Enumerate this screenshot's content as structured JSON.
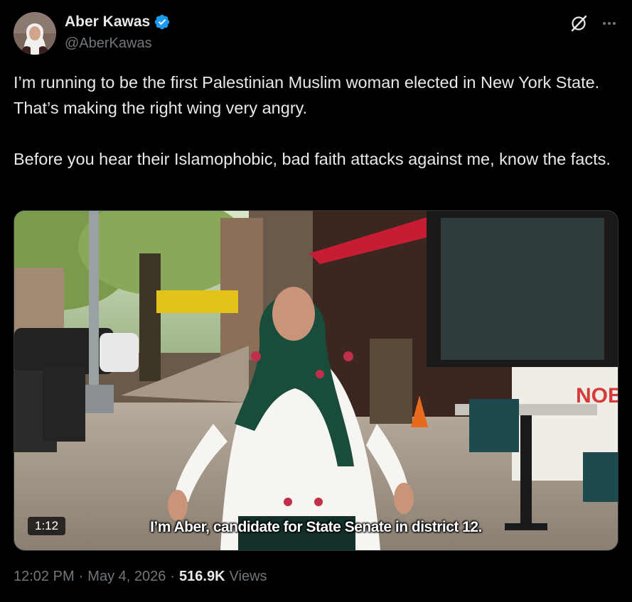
{
  "author": {
    "name": "Aber Kawas",
    "handle": "@AberKawas",
    "verified_color": "#1d9bf0"
  },
  "icons": {
    "grok": "grok-icon",
    "more": "more-icon",
    "verified": "verified-badge-icon"
  },
  "tweet": {
    "paragraph_1": "I’m running to be the first Palestinian Muslim woman elected in New York State. That’s making the right wing very angry.",
    "paragraph_2": "Before you hear their Islamophobic, bad faith attacks against me, know the facts."
  },
  "video": {
    "duration": "1:12",
    "caption": "I’m Aber, candidate for State Senate in district 12."
  },
  "meta": {
    "time": "12:02 PM",
    "separator_1": "·",
    "date": "May 4, 2026",
    "separator_2": "·",
    "views_count": "516.9K",
    "views_label": "Views"
  }
}
